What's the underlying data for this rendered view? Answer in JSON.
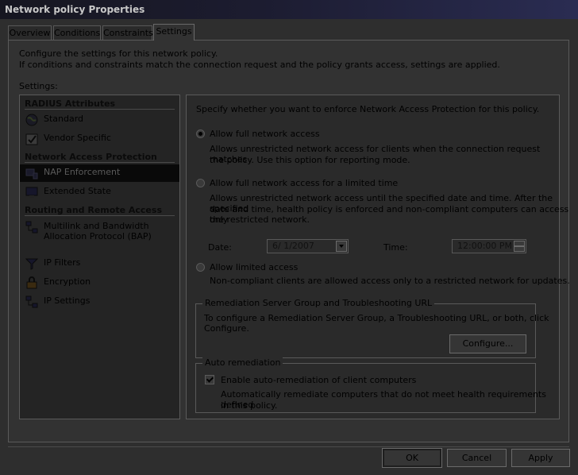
{
  "window": {
    "title": "Network policy Properties"
  },
  "tabs": [
    {
      "label": "Overview"
    },
    {
      "label": "Conditions"
    },
    {
      "label": "Constraints"
    },
    {
      "label": "Settings"
    }
  ],
  "description": {
    "line1": "Configure the settings for this network policy.",
    "line2": "If conditions and constraints match the connection request and the policy grants access, settings are applied."
  },
  "settings_label": "Settings:",
  "sidebar": {
    "categories": [
      {
        "label": "RADIUS Attributes"
      },
      {
        "label": "Network Access Protection"
      },
      {
        "label": "Routing and Remote Access"
      }
    ],
    "items": [
      {
        "label": "Standard",
        "icon": "globe-icon"
      },
      {
        "label": "Vendor Specific",
        "icon": "checklist-icon"
      },
      {
        "label": "NAP Enforcement",
        "icon": "nap-enforcement-icon",
        "selected": true
      },
      {
        "label": "Extended State",
        "icon": "monitor-icon"
      },
      {
        "label": "Multilink and Bandwidth",
        "label2": "Allocation Protocol (BAP)",
        "icon": "network-icon"
      },
      {
        "label": "IP Filters",
        "icon": "filter-icon"
      },
      {
        "label": "Encryption",
        "icon": "lock-icon"
      },
      {
        "label": "IP Settings",
        "icon": "network-icon"
      }
    ]
  },
  "main": {
    "intro": "Specify whether you want to enforce Network Access Protection for this policy.",
    "options": [
      {
        "label": "Allow full network access",
        "checked": true,
        "desc1": "Allows unrestricted network access for clients when the connection request matches",
        "desc2": "the policy.  Use this option for reporting mode."
      },
      {
        "label": "Allow full network access for a limited time",
        "checked": false,
        "desc1": "Allows unrestricted network access until the specified date and time. After the specified",
        "desc2": "date and time, health policy is enforced and non-compliant computers can access only",
        "desc3": "the restricted network."
      },
      {
        "label": "Allow limited access",
        "checked": false,
        "desc1": "Non-compliant clients are allowed access only to a restricted network for updates."
      }
    ],
    "date": {
      "label": "Date:",
      "value": "6/ 1/2007"
    },
    "time": {
      "label": "Time:",
      "value": "12:00:00 PM"
    },
    "remediation": {
      "legend": "Remediation Server Group and Troubleshooting URL",
      "text1": "To configure a Remediation Server Group, a Troubleshooting URL, or both, click",
      "text2": "Configure.",
      "button": "Configure..."
    },
    "auto": {
      "legend": "Auto remediation",
      "checkbox_label": "Enable auto-remediation of client computers",
      "checked": true,
      "desc1": "Automatically remediate computers that do not meet health requirements defined",
      "desc2": "in this policy."
    }
  },
  "footer": {
    "ok": "OK",
    "cancel": "Cancel",
    "apply": "Apply"
  }
}
